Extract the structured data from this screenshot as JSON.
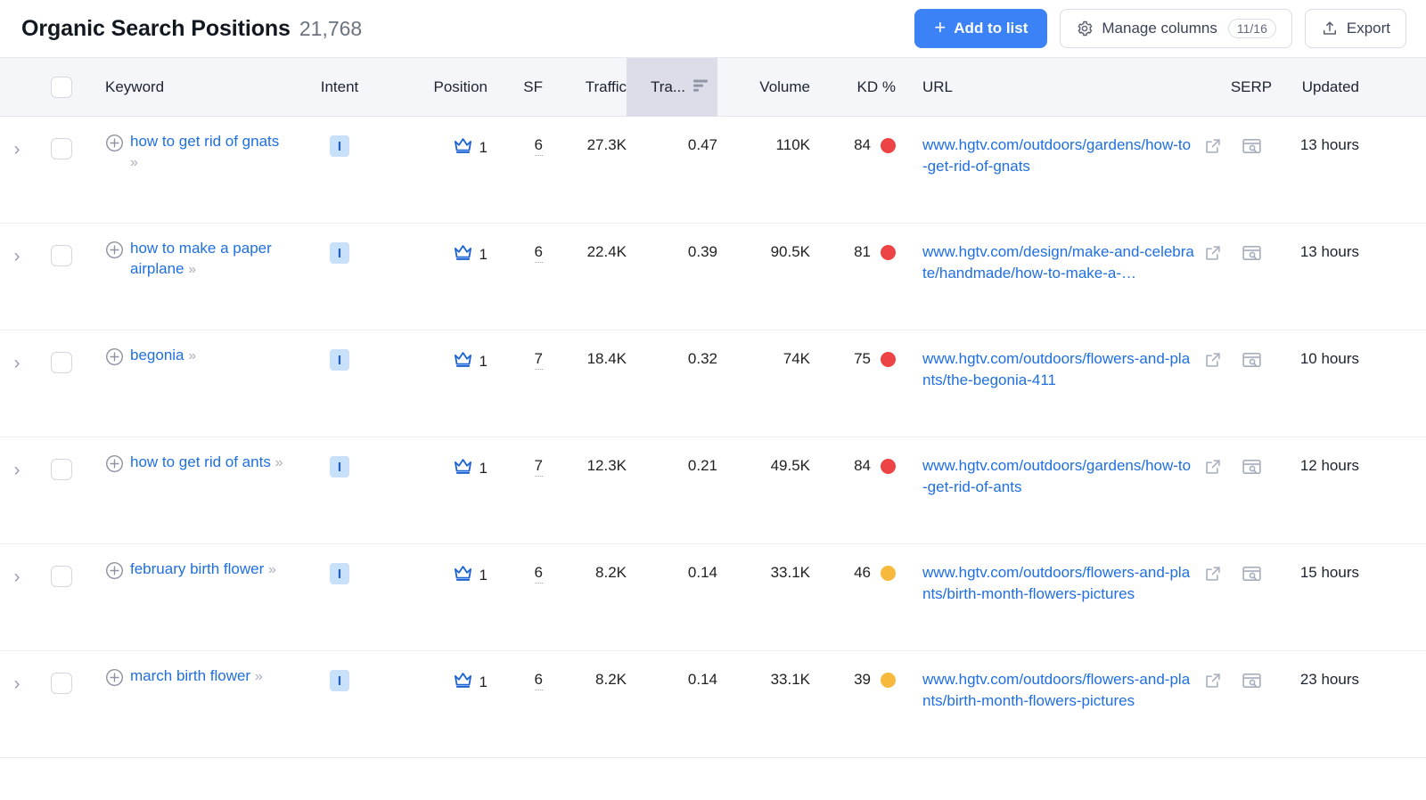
{
  "header": {
    "title": "Organic Search Positions",
    "count": "21,768",
    "add_to_list_label": "Add to list",
    "add_to_list_plus": "+",
    "manage_columns_label": "Manage columns",
    "manage_columns_badge": "11/16",
    "export_label": "Export"
  },
  "colors": {
    "accent": "#3b82f6",
    "link": "#1f6fe0",
    "kd_high": "#ec4444",
    "kd_medium": "#f6b93b",
    "intent_badge_bg": "#c9e0fb",
    "intent_badge_fg": "#2060c4",
    "header_bg": "#f5f6fa",
    "sorted_col_bg": "#dcdde8"
  },
  "table": {
    "columns": [
      {
        "key": "keyword",
        "label": "Keyword"
      },
      {
        "key": "intent",
        "label": "Intent"
      },
      {
        "key": "position",
        "label": "Position"
      },
      {
        "key": "sf",
        "label": "SF"
      },
      {
        "key": "traffic",
        "label": "Traffic"
      },
      {
        "key": "traffic_pct",
        "label": "Tra...",
        "sorted": true
      },
      {
        "key": "volume",
        "label": "Volume"
      },
      {
        "key": "kd",
        "label": "KD %"
      },
      {
        "key": "url",
        "label": "URL"
      },
      {
        "key": "serp",
        "label": "SERP"
      },
      {
        "key": "updated",
        "label": "Updated"
      }
    ],
    "rows": [
      {
        "keyword": "how to get rid of gnats",
        "intent": "I",
        "position": "1",
        "sf": "6",
        "traffic": "27.3K",
        "traffic_pct": "0.47",
        "volume": "110K",
        "kd": "84",
        "kd_level": "high",
        "url": "www.hgtv.com/outdoors/gardens/how-to-get-rid-of-gnats",
        "updated": "13 hours"
      },
      {
        "keyword": "how to make a paper airplane",
        "intent": "I",
        "position": "1",
        "sf": "6",
        "traffic": "22.4K",
        "traffic_pct": "0.39",
        "volume": "90.5K",
        "kd": "81",
        "kd_level": "high",
        "url": "www.hgtv.com/design/make-and-celebrate/handmade/how-to-make-a-…",
        "updated": "13 hours"
      },
      {
        "keyword": "begonia",
        "intent": "I",
        "position": "1",
        "sf": "7",
        "traffic": "18.4K",
        "traffic_pct": "0.32",
        "volume": "74K",
        "kd": "75",
        "kd_level": "high",
        "url": "www.hgtv.com/outdoors/flowers-and-plants/the-begonia-411",
        "updated": "10 hours"
      },
      {
        "keyword": "how to get rid of ants",
        "intent": "I",
        "position": "1",
        "sf": "7",
        "traffic": "12.3K",
        "traffic_pct": "0.21",
        "volume": "49.5K",
        "kd": "84",
        "kd_level": "high",
        "url": "www.hgtv.com/outdoors/gardens/how-to-get-rid-of-ants",
        "updated": "12 hours"
      },
      {
        "keyword": "february birth flower",
        "intent": "I",
        "position": "1",
        "sf": "6",
        "traffic": "8.2K",
        "traffic_pct": "0.14",
        "volume": "33.1K",
        "kd": "46",
        "kd_level": "medium",
        "url": "www.hgtv.com/outdoors/flowers-and-plants/birth-month-flowers-pictures",
        "updated": "15 hours"
      },
      {
        "keyword": "march birth flower",
        "intent": "I",
        "position": "1",
        "sf": "6",
        "traffic": "8.2K",
        "traffic_pct": "0.14",
        "volume": "33.1K",
        "kd": "39",
        "kd_level": "medium",
        "url": "www.hgtv.com/outdoors/flowers-and-plants/birth-month-flowers-pictures",
        "updated": "23 hours"
      }
    ]
  },
  "icons": {
    "expand_chevron": "›",
    "keyword_expand_chevrons": "»"
  }
}
